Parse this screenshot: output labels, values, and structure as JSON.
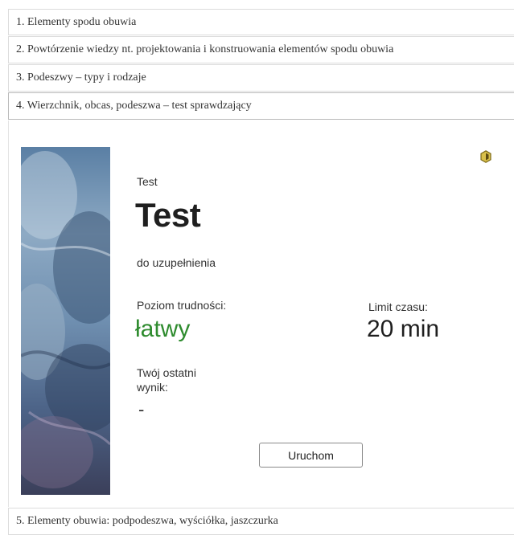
{
  "nav": {
    "items": [
      {
        "label": "1. Elementy spodu obuwia"
      },
      {
        "label": "2. Powtórzenie wiedzy nt. projektowania i konstruowania elementów spodu obuwia"
      },
      {
        "label": "3. Podeszwy – typy i rodzaje"
      },
      {
        "label": "4. Wierzchnik, obcas, podeszwa – test sprawdzający"
      },
      {
        "label": "5. Elementy obuwia: podpodeszwa, wyściółka, jaszczurka"
      }
    ]
  },
  "card": {
    "kind": "Test",
    "title": "Test",
    "status": "do uzupełnienia",
    "difficulty_label": "Poziom trudności:",
    "difficulty_value": "łatwy",
    "time_label": "Limit czasu:",
    "time_value": "20 min",
    "last_result_label": "Twój ostatni wynik:",
    "last_result_value": "-",
    "start_label": "Uruchom",
    "badge_icon": "hexagon-badge-icon"
  },
  "colors": {
    "difficulty": "#2e8b2e",
    "badge": "#b8a12a"
  }
}
